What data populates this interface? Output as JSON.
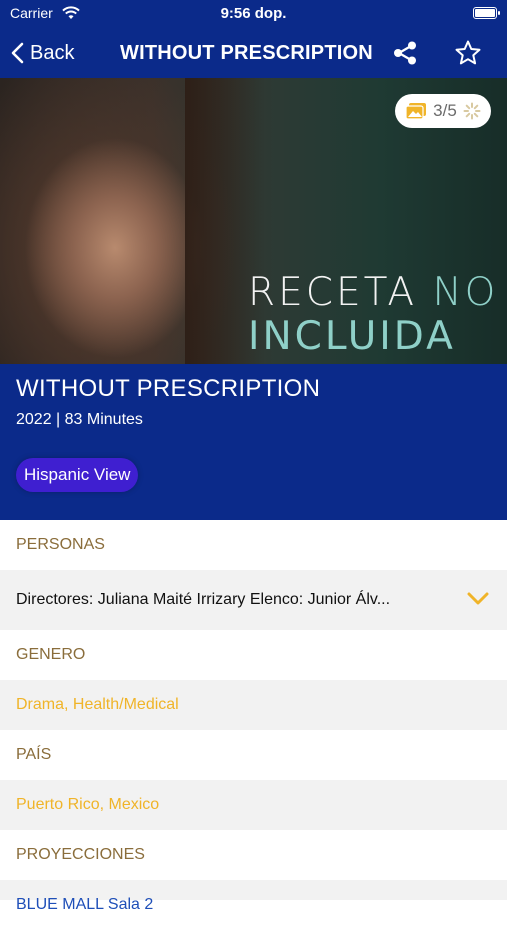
{
  "status_bar": {
    "carrier": "Carrier",
    "time": "9:56 dop."
  },
  "nav": {
    "back_label": "Back",
    "title": "WITHOUT PRESCRIPTION"
  },
  "hero": {
    "counter": "3/5",
    "poster_word1": "RECETA",
    "poster_word2": "NO",
    "poster_line2": "INCLUIDA"
  },
  "movie": {
    "title": "WITHOUT PRESCRIPTION",
    "meta": "2022 | 83 Minutes",
    "tag": "Hispanic View"
  },
  "sections": {
    "personas_header": "PERSONAS",
    "people_line": "Directores:  Juliana Maité Irrizary  Elenco:  Junior Álv...",
    "genero_header": "GENERO",
    "genero_value": "Drama, Health/Medical",
    "pais_header": "PAÍS",
    "pais_value": "Puerto Rico, Mexico",
    "proyecciones_header": "PROYECCIONES",
    "proyecciones_value": "BLUE MALL Sala 2"
  },
  "colors": {
    "nav_blue": "#0b2a8a",
    "accent_gold": "#f0b429",
    "header_brown": "#8a6d3b",
    "tag_purple": "#3f1fd0"
  },
  "icons": [
    "wifi-icon",
    "battery-icon",
    "back-chevron-icon",
    "share-icon",
    "star-icon",
    "gallery-icon",
    "spinner-icon",
    "chevron-down-icon"
  ]
}
